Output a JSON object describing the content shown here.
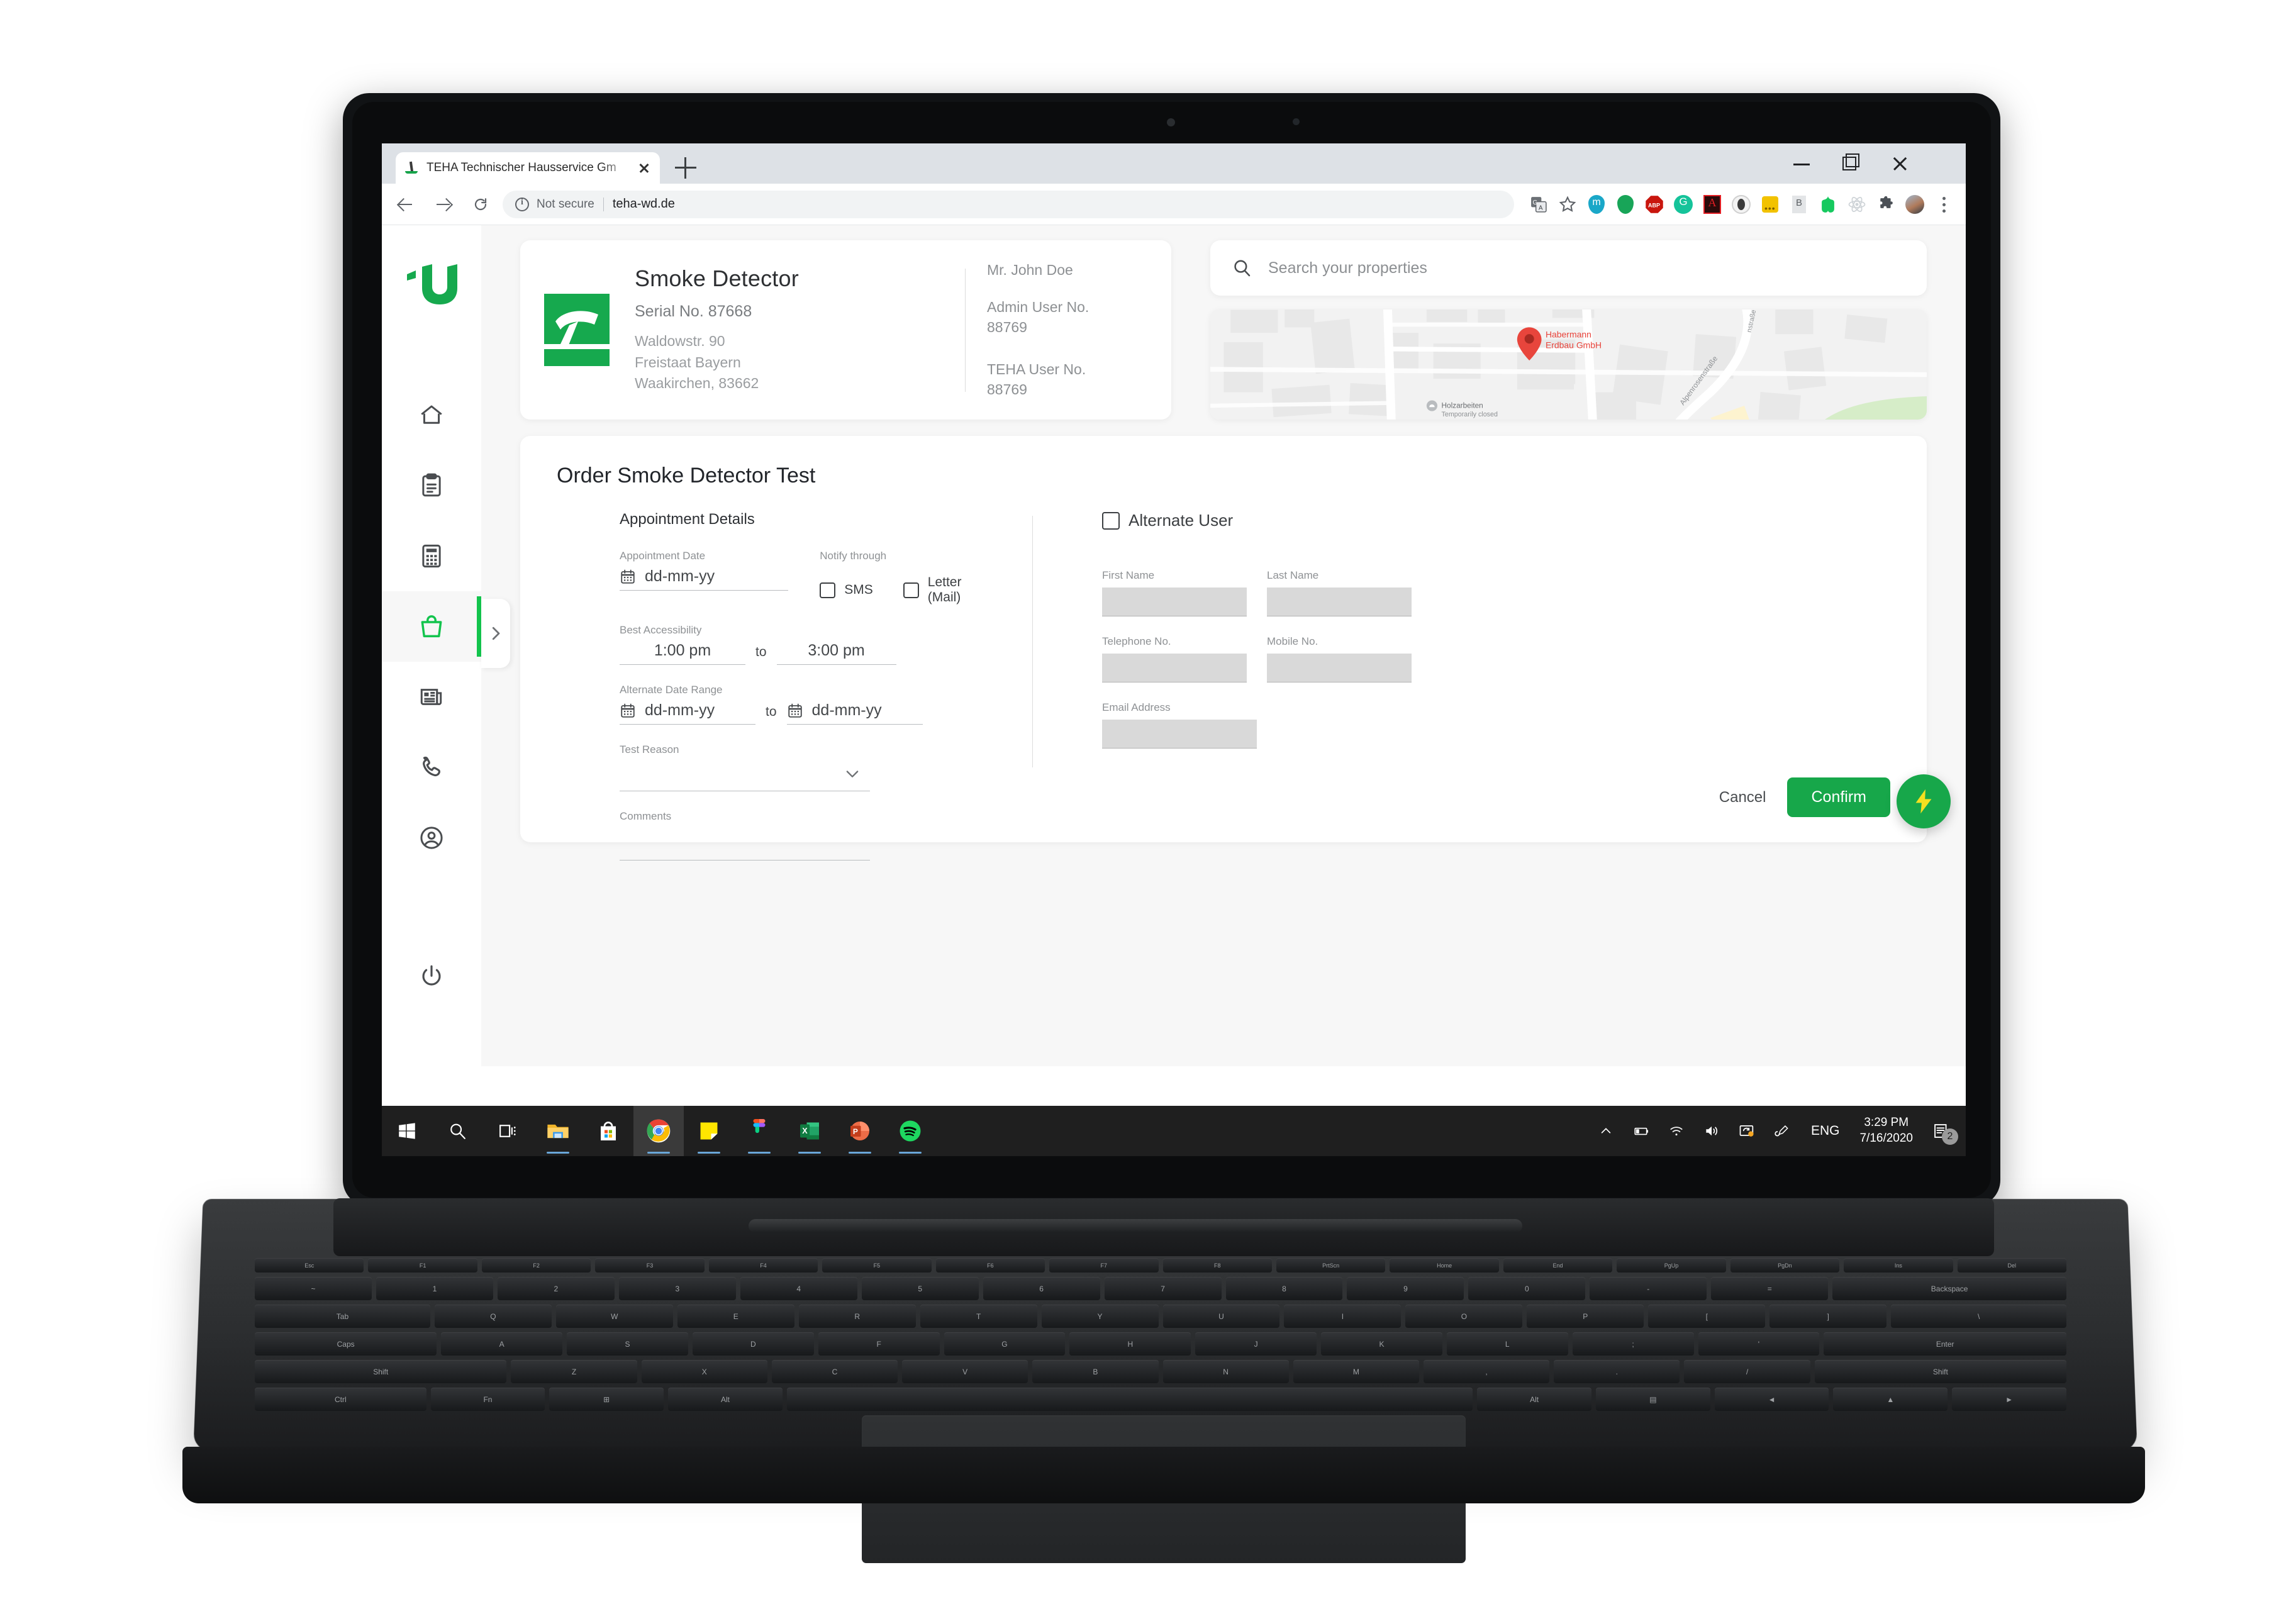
{
  "browser": {
    "tab": {
      "title": "TEHA Technischer Hausservice Gm",
      "favicon": "teha-favicon"
    },
    "newtab_label": "+",
    "window_controls": {
      "minimize": "minimize",
      "maximize": "maximize",
      "close": "close"
    },
    "omnibox": {
      "security_text": "Not secure",
      "url": "teha-wd.de"
    },
    "extensions": [
      {
        "name": "google-translate-icon",
        "color": "#5f6368"
      },
      {
        "name": "bookmark-star-icon",
        "color": "#5f6368"
      },
      {
        "name": "mendeley-extension-icon",
        "color": "#1aa7c8"
      },
      {
        "name": "green-pin-extension-icon",
        "color": "#18a558"
      },
      {
        "name": "adblock-plus-icon",
        "color": "#c9160e"
      },
      {
        "name": "grammarly-icon",
        "color": "#15c39a"
      },
      {
        "name": "adobe-acrobat-icon",
        "color": "#b01a1a"
      },
      {
        "name": "onepassword-icon",
        "color": "#6b6b6b"
      },
      {
        "name": "yellow-dots-extension-icon",
        "color": "#f2c200"
      },
      {
        "name": "bitwarden-icon",
        "color": "#8d9296"
      },
      {
        "name": "evernote-web-clipper-icon",
        "color": "#16c95f"
      },
      {
        "name": "react-devtools-icon",
        "color": "#cfd4d8"
      },
      {
        "name": "extensions-puzzle-icon",
        "color": "#4b5056"
      },
      {
        "name": "profile-avatar",
        "color": "#b07a5a"
      },
      {
        "name": "chrome-menu-icon",
        "color": "#5f6368"
      }
    ]
  },
  "sidebar": {
    "logo": "teha-logo",
    "items": [
      {
        "name": "home",
        "icon": "home-icon",
        "active": false
      },
      {
        "name": "tasks",
        "icon": "clipboard-icon",
        "active": false
      },
      {
        "name": "invoices",
        "icon": "calculator-icon",
        "active": false
      },
      {
        "name": "orders",
        "icon": "basket-icon",
        "active": true
      },
      {
        "name": "news",
        "icon": "newspaper-icon",
        "active": false
      },
      {
        "name": "contact",
        "icon": "phone-icon",
        "active": false
      },
      {
        "name": "account",
        "icon": "user-circle-icon",
        "active": false
      },
      {
        "name": "logout",
        "icon": "power-icon",
        "active": false
      }
    ],
    "collapse_icon": "chevron-right-icon"
  },
  "detector_card": {
    "icon": "smoke-detector-icon",
    "title": "Smoke Detector",
    "serial": "Serial No. 87668",
    "address_lines": [
      "Waldowstr. 90",
      "Freistaat Bayern",
      "Waakirchen, 83662"
    ],
    "contact": {
      "name": "Mr. John Doe",
      "admin_label": "Admin User No.",
      "admin_value": "88769",
      "teha_label": "TEHA User No.",
      "teha_value": "88769"
    }
  },
  "search": {
    "icon": "search-icon",
    "placeholder": "Search your properties",
    "value": ""
  },
  "map": {
    "pin_label_line1": "Habermann",
    "pin_label_line2": "Erdbau GmbH",
    "poi_name": "Holzarbeiten",
    "poi_status": "Temporarily closed",
    "street_1": "Alpenrosenstraße",
    "street_2": "nstraße",
    "pin_color": "#e8453c"
  },
  "order_form": {
    "title": "Order Smoke Detector Test",
    "section_appointment": "Appointment Details",
    "fields": {
      "appointment_date": {
        "label": "Appointment Date",
        "value": "dd-mm-yy",
        "icon": "calendar-icon"
      },
      "notify_through": {
        "label": "Notify through",
        "options": [
          {
            "label": "SMS",
            "checked": false
          },
          {
            "label": "Letter (Mail)",
            "checked": false
          }
        ]
      },
      "best_accessibility": {
        "label": "Best Accessibility",
        "from": "1:00 pm",
        "separator": "to",
        "to": "3:00 pm"
      },
      "alternate_date_range": {
        "label": "Alternate Date Range",
        "from": "dd-mm-yy",
        "separator": "to",
        "to": "dd-mm-yy",
        "icon": "calendar-icon"
      },
      "test_reason": {
        "label": "Test Reason",
        "value": "",
        "icon": "chevron-down-icon"
      },
      "comments": {
        "label": "Comments",
        "value": ""
      }
    },
    "alternate_user": {
      "checkbox_label": "Alternate User",
      "checked": false,
      "fields": [
        {
          "label": "First Name",
          "value": ""
        },
        {
          "label": "Last Name",
          "value": ""
        },
        {
          "label": "Telephone No.",
          "value": ""
        },
        {
          "label": "Mobile No.",
          "value": ""
        },
        {
          "label": "Email Address",
          "value": ""
        }
      ]
    },
    "actions": {
      "cancel_label": "Cancel",
      "confirm_label": "Confirm",
      "fab_icon": "lightning-bolt-icon"
    }
  },
  "colors": {
    "brand_green": "#13c44d",
    "confirm_green": "#17a74a",
    "fab_yellow": "#f5e020",
    "page_bg": "#f7f7f7"
  },
  "taskbar": {
    "items": [
      {
        "name": "start-button",
        "icon": "windows-logo-icon"
      },
      {
        "name": "search-button",
        "icon": "search-icon"
      },
      {
        "name": "task-view-button",
        "icon": "task-view-icon"
      },
      {
        "name": "file-explorer",
        "icon": "folder-icon",
        "running": true
      },
      {
        "name": "microsoft-store",
        "icon": "store-icon",
        "running": false
      },
      {
        "name": "google-chrome",
        "icon": "chrome-icon",
        "running": true,
        "active": true
      },
      {
        "name": "sticky-notes",
        "icon": "sticky-note-icon",
        "running": true
      },
      {
        "name": "figma",
        "icon": "figma-icon",
        "running": true
      },
      {
        "name": "excel",
        "icon": "excel-icon",
        "running": true
      },
      {
        "name": "powerpoint",
        "icon": "powerpoint-icon",
        "running": true
      },
      {
        "name": "spotify",
        "icon": "spotify-icon",
        "running": true
      }
    ],
    "tray": {
      "overflow_icon": "chevron-up-icon",
      "battery_icon": "battery-icon",
      "wifi_icon": "wifi-icon",
      "volume_icon": "volume-icon",
      "onedrive_icon": "onedrive-icon",
      "pen_icon": "pen-icon",
      "language": "ENG",
      "time": "3:29 PM",
      "date": "7/16/2020",
      "action_center_icon": "action-center-icon",
      "notification_count": "2"
    }
  }
}
